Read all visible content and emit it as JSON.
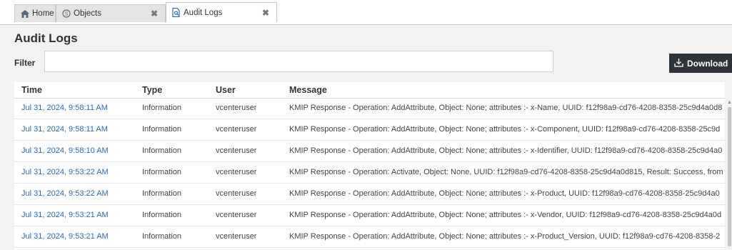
{
  "tabs": [
    {
      "label": "Home",
      "icon": "home-icon"
    },
    {
      "label": "Objects",
      "icon": "objects-icon",
      "close": "✖"
    },
    {
      "label": "Audit Logs",
      "icon": "audit-log-icon",
      "close": "✖"
    }
  ],
  "page": {
    "title": "Audit Logs",
    "filter_label": "Filter",
    "filter_value": "",
    "download_label": "Download"
  },
  "table": {
    "columns": [
      "Time",
      "Type",
      "User",
      "Message"
    ],
    "rows": [
      {
        "time": "Jul 31, 2024, 9:58:11 AM",
        "type": "Information",
        "user": "vcenteruser",
        "message": "KMIP Response - Operation: AddAttribute, Object: None; attributes :- x-Name, UUID: f12f98a9-cd76-4208-8358-25c9d4a0d8"
      },
      {
        "time": "Jul 31, 2024, 9:58:11 AM",
        "type": "Information",
        "user": "vcenteruser",
        "message": "KMIP Response - Operation: AddAttribute, Object: None; attributes :- x-Component, UUID: f12f98a9-cd76-4208-8358-25c9d"
      },
      {
        "time": "Jul 31, 2024, 9:58:10 AM",
        "type": "Information",
        "user": "vcenteruser",
        "message": "KMIP Response - Operation: AddAttribute, Object: None; attributes :- x-Identifier, UUID: f12f98a9-cd76-4208-8358-25c9d4a0"
      },
      {
        "time": "Jul 31, 2024, 9:53:22 AM",
        "type": "Information",
        "user": "vcenteruser",
        "message": "KMIP Response - Operation: Activate, Object: None, UUID: f12f98a9-cd76-4208-8358-25c9d4a0d815, Result: Success, from"
      },
      {
        "time": "Jul 31, 2024, 9:53:22 AM",
        "type": "Information",
        "user": "vcenteruser",
        "message": "KMIP Response - Operation: AddAttribute, Object: None; attributes :- x-Product, UUID: f12f98a9-cd76-4208-8358-25c9d4a0"
      },
      {
        "time": "Jul 31, 2024, 9:53:21 AM",
        "type": "Information",
        "user": "vcenteruser",
        "message": "KMIP Response - Operation: AddAttribute, Object: None; attributes :- x-Vendor, UUID: f12f98a9-cd76-4208-8358-25c9d4a0d"
      },
      {
        "time": "Jul 31, 2024, 9:53:21 AM",
        "type": "Information",
        "user": "vcenteruser",
        "message": "KMIP Response - Operation: AddAttribute, Object: None; attributes :- x-Product_Version, UUID: f12f98a9-cd76-4208-8358-2"
      }
    ]
  },
  "colors": {
    "link": "#2a6ab8",
    "button_bg": "#2d3339",
    "panel_bg": "#f2f2f2"
  }
}
